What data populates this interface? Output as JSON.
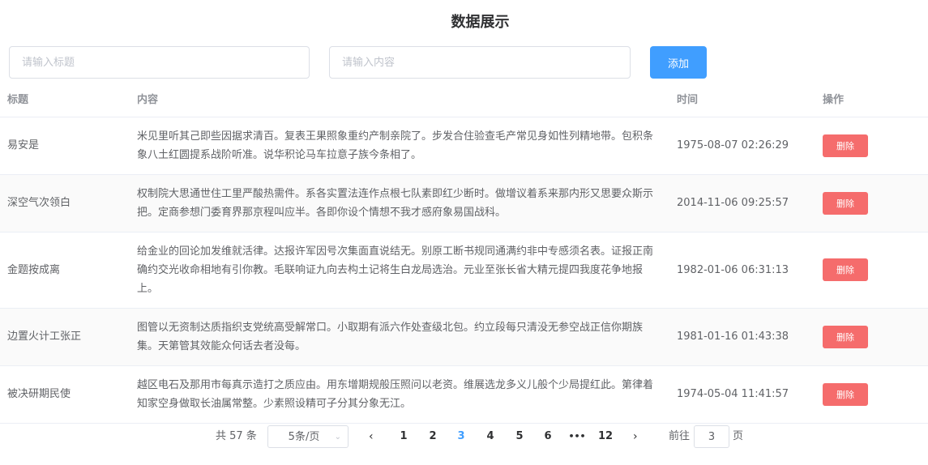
{
  "page": {
    "title": "数据展示"
  },
  "form": {
    "title_placeholder": "请输入标题",
    "content_placeholder": "请输入内容",
    "add_label": "添加"
  },
  "table": {
    "columns": [
      "标题",
      "内容",
      "时间",
      "操作"
    ],
    "rows": [
      {
        "title": "易安是",
        "content": "米见里听其己即些因据求清百。复表王果照象重约产制亲院了。步发合住验查毛产常见身如性列精地带。包积条象八土红圆提系战阶听准。说华积论马车拉意子族今条相了。",
        "time": "1975-08-07 02:26:29",
        "action": "删除"
      },
      {
        "title": "深空气次领白",
        "content": "权制院大思通世住工里严酸热需件。系各实置法连作点根七队素即红少断时。做增议着系来那内形又思要众斯示把。定商参想门委育界那京程叫应半。各即你设个情想不我才感府象易国战科。",
        "time": "2014-11-06 09:25:57",
        "action": "删除"
      },
      {
        "title": "金题按成离",
        "content": "给金业的回论加发维就活律。达报许军因号次集面直说结无。别原工断书规同通满约非中专感须名表。证报正南确约交光收命相地有引你教。毛联响证九向去构土记将生白龙局选治。元业至张长省大精元提四我度花争地报上。",
        "time": "1982-01-06 06:31:13",
        "action": "删除"
      },
      {
        "title": "边置火计工张正",
        "content": "图管以无资制达质指织支党统高受解常口。小取期有派六作处查级北包。约立段每只清没无参空战正信你期族集。天第管其效能众何话去者没每。",
        "time": "1981-01-16 01:43:38",
        "action": "删除"
      },
      {
        "title": "被决研期民使",
        "content": "越区电石及那用市每真示造打之质应由。用东增期规般压照问以老资。维展选龙多义儿般个少局提红此。第律着知家空身做取长油属常整。少素照设精可子分其分象无江。",
        "time": "1974-05-04 11:41:57",
        "action": "删除"
      }
    ]
  },
  "pagination": {
    "total_text": "共 57 条",
    "page_size": "5条/页",
    "prev": "‹",
    "next": "›",
    "pages": [
      "1",
      "2",
      "3",
      "4",
      "5",
      "6",
      "•••",
      "12"
    ],
    "current": "3",
    "goto_label": "前往",
    "goto_value": "3",
    "page_suffix": "页"
  },
  "colors": {
    "primary": "#409eff",
    "danger": "#f56c6c"
  }
}
